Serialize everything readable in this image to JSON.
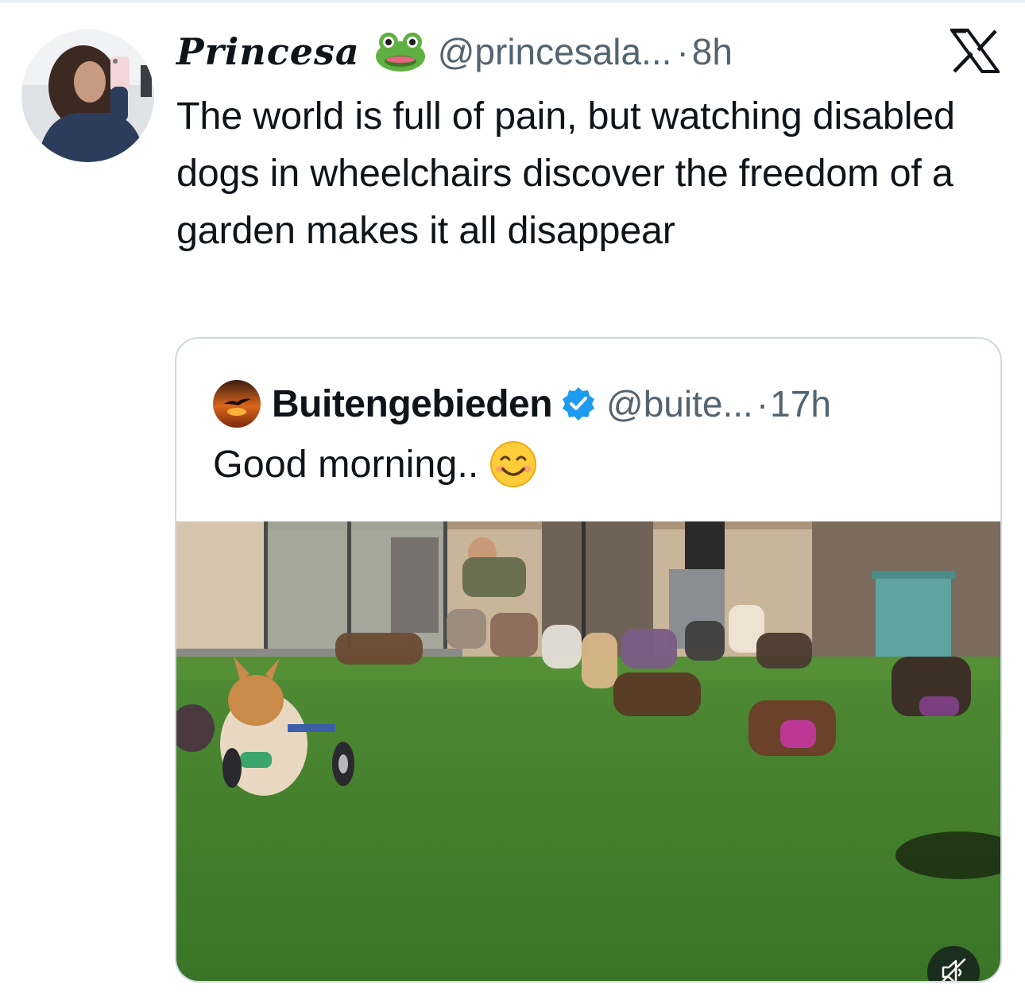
{
  "tweet": {
    "display_name": "Princesa",
    "handle": "@princesala...",
    "dot": "·",
    "time": "8h",
    "text": "The world is full of pain, but watching disabled dogs in wheelchairs discover the freedom of a garden makes it all disappear",
    "emoji_icon": "frog-face-icon"
  },
  "quoted_tweet": {
    "display_name": "Buitengebieden",
    "verified": true,
    "handle": "@buite...",
    "dot": "·",
    "time": "17h",
    "text": "Good morning..",
    "emoji_icon": "smiling-face-icon"
  },
  "media": {
    "type": "video",
    "muted_icon": "speaker-muted-icon"
  },
  "colors": {
    "secondary_text": "#536471",
    "primary_text": "#0f1419",
    "verified_blue": "#1d9bf0",
    "card_border": "#cfd9de"
  }
}
